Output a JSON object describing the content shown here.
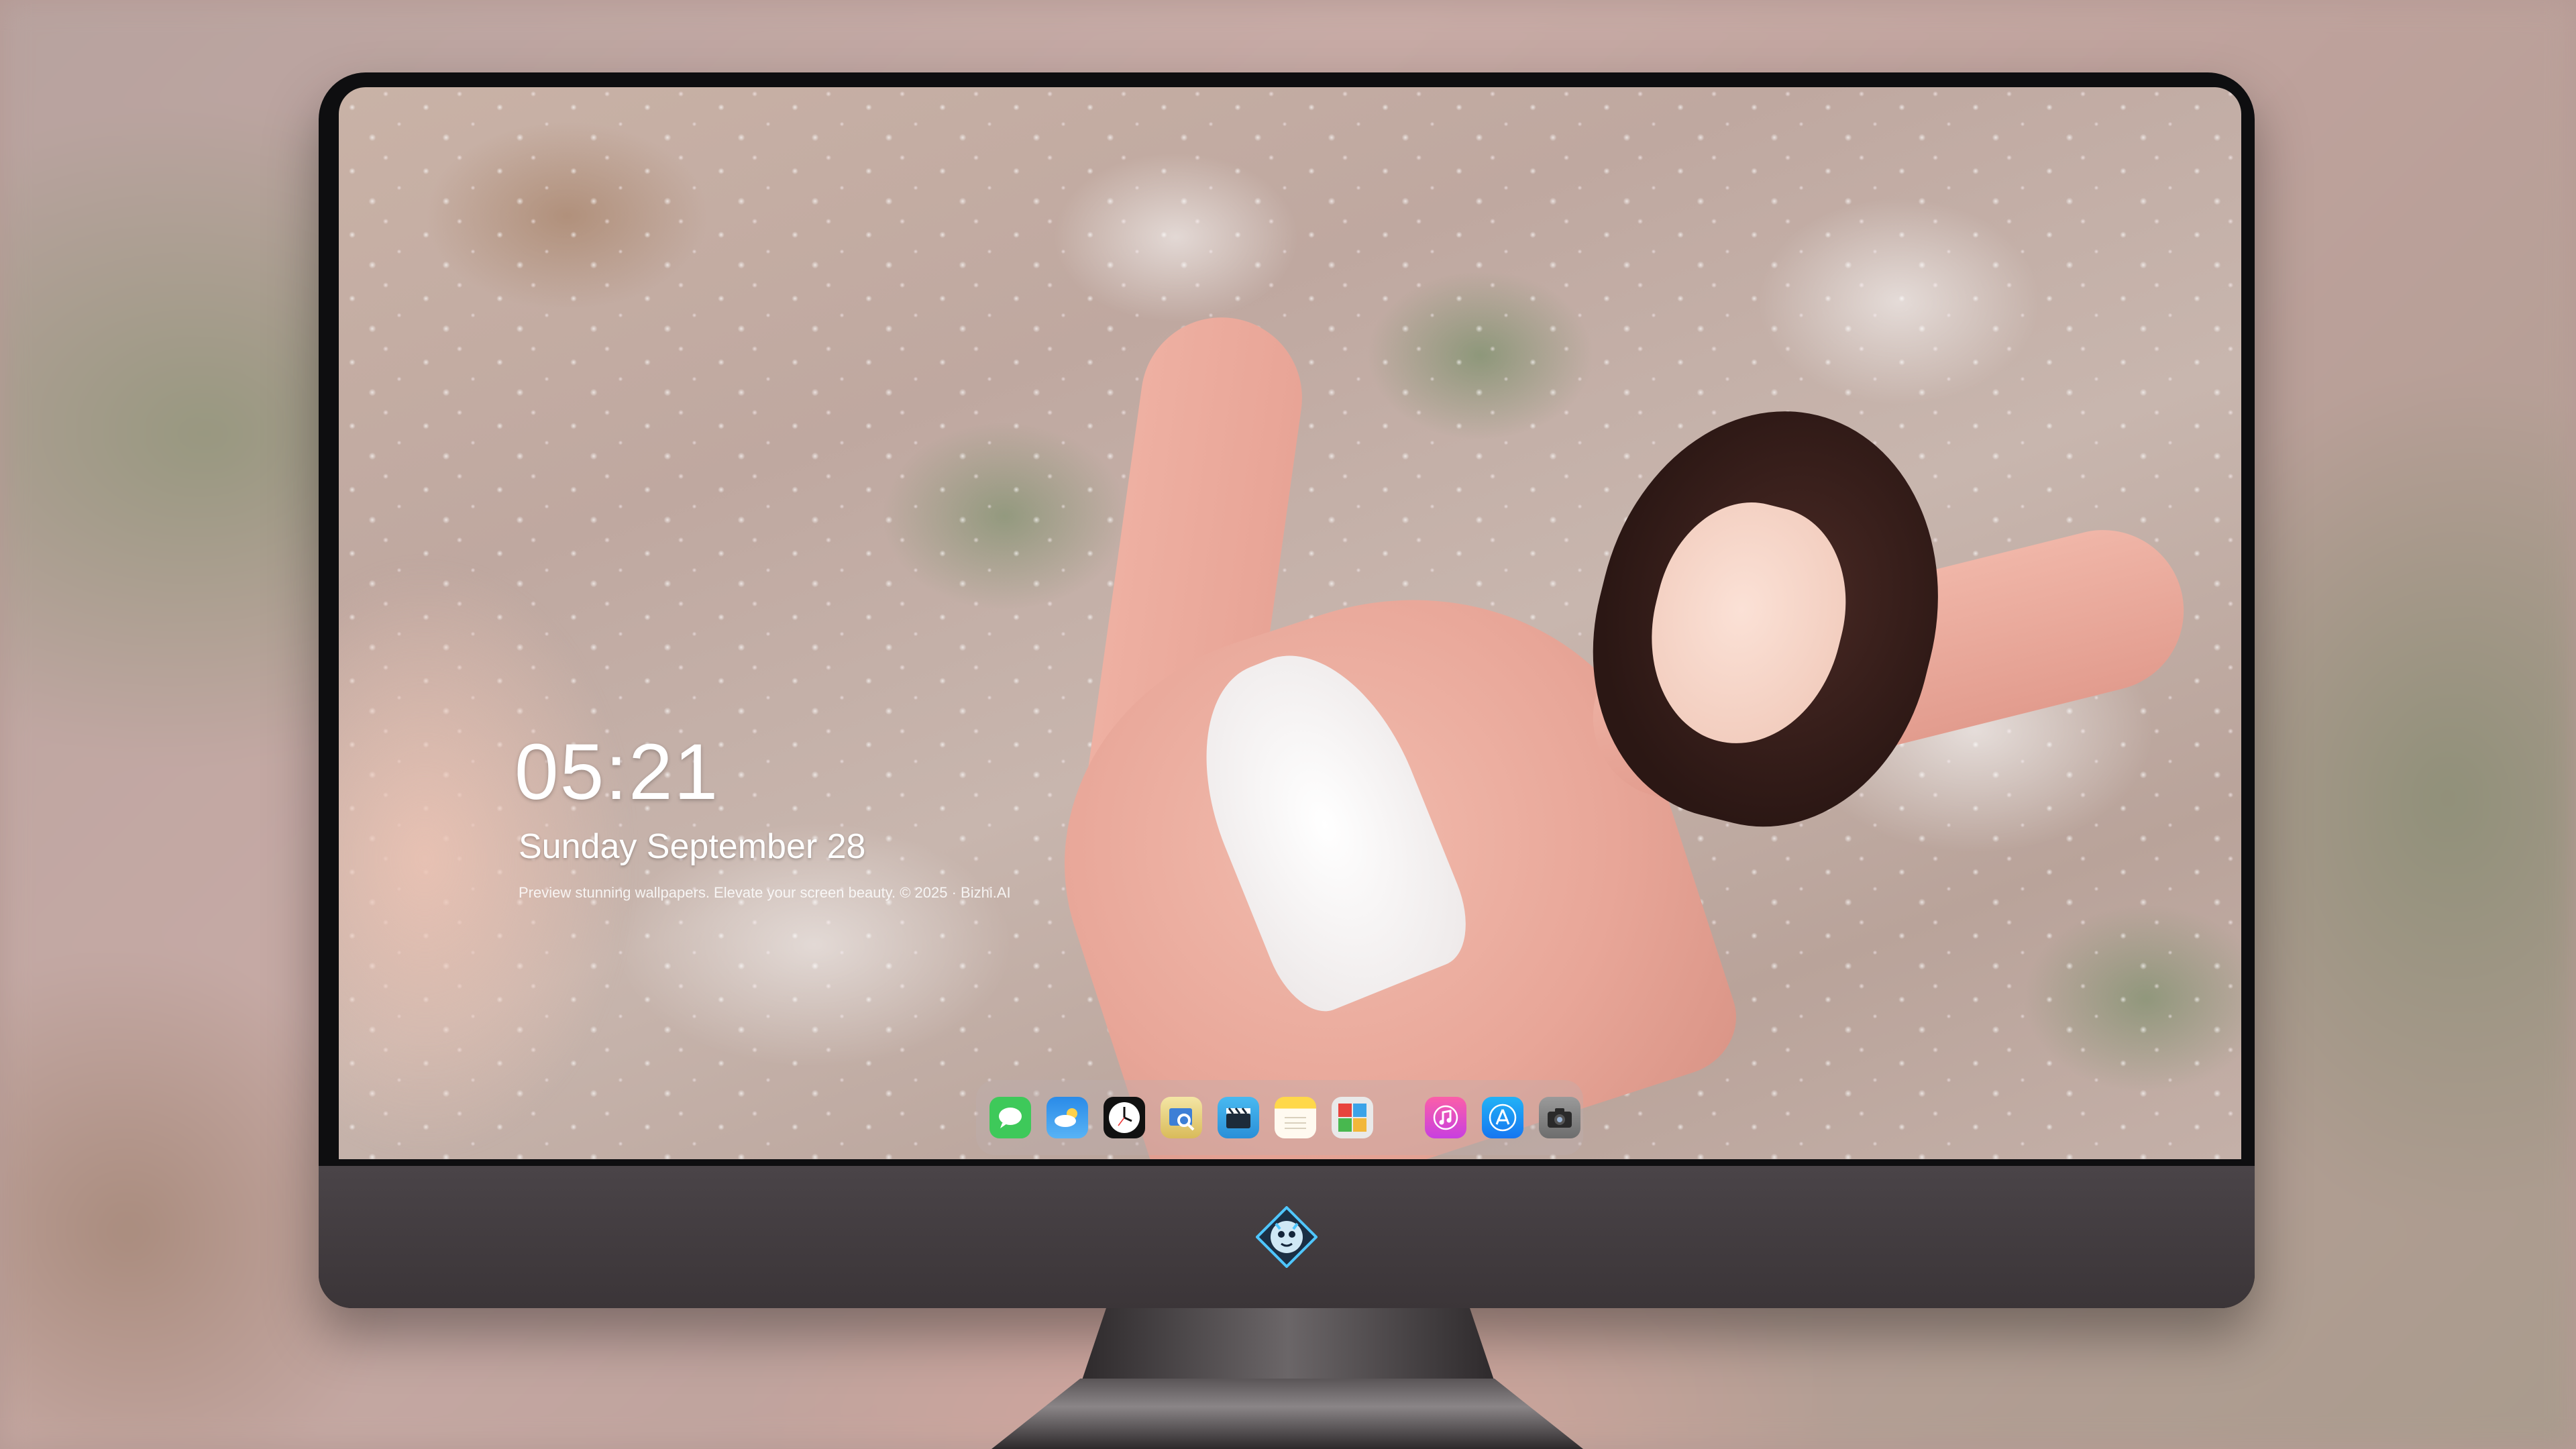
{
  "lock_screen": {
    "time": "05:21",
    "date": "Sunday September  28",
    "credit": "Preview stunning wallpapers. Elevate your screen beauty. © 2025 · Bizhi.AI"
  },
  "dock": {
    "apps": [
      {
        "name": "Messages",
        "icon": "messages-icon",
        "color": "#3ec95a"
      },
      {
        "name": "Weather",
        "icon": "weather-icon",
        "color": "#2f9cf0"
      },
      {
        "name": "Clock",
        "icon": "clock-icon",
        "color": "#111111"
      },
      {
        "name": "Preview",
        "icon": "preview-icon",
        "color": "#e9d487"
      },
      {
        "name": "Video",
        "icon": "clapper-icon",
        "color": "#36a9e9"
      },
      {
        "name": "Notes",
        "icon": "notes-icon",
        "color": "#ffd84a"
      },
      {
        "name": "Photo Booth",
        "icon": "photobooth-icon",
        "color": "#cf3c3c"
      },
      {
        "name": "Music",
        "icon": "music-icon",
        "color": "#fb4ea2"
      },
      {
        "name": "App Store",
        "icon": "appstore-icon",
        "color": "#1d8ef5"
      },
      {
        "name": "Camera",
        "icon": "camera-icon",
        "color": "#8c8c8c"
      }
    ]
  },
  "colors": {
    "accent": "#e8a698",
    "monitor_chin": "#3b3538"
  },
  "chin_logo": "cartoon-dragon-logo"
}
